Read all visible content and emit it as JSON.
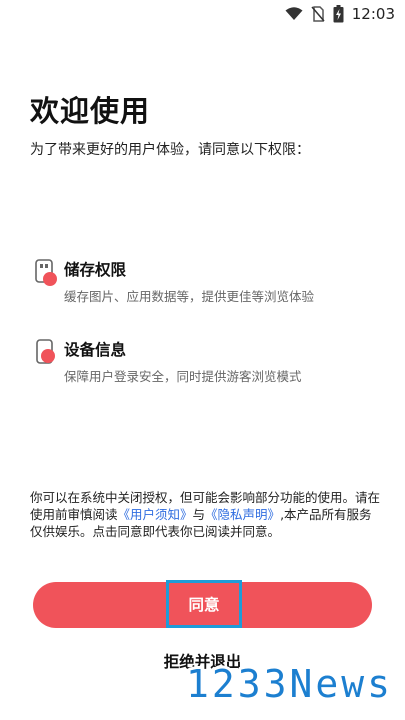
{
  "status_bar": {
    "time": "12:03",
    "icons": [
      "wifi-icon",
      "no-sim-icon",
      "battery-charging-icon"
    ]
  },
  "title": "欢迎使用",
  "subtitle": "为了带来更好的用户体验，请同意以下权限：",
  "permissions": [
    {
      "icon": "storage-icon",
      "title": "储存权限",
      "desc": "缓存图片、应用数据等，提供更佳等浏览体验"
    },
    {
      "icon": "device-info-icon",
      "title": "设备信息",
      "desc": "保障用户登录安全，同时提供游客浏览模式"
    }
  ],
  "notice": {
    "line1": "你可以在系统中关闭授权，但可能会影响部分功能的使用。请在使用前审慎阅读",
    "user_terms_link": "《用户须知》",
    "and": "与",
    "privacy_link": "《隐私声明》",
    "line2": ",本产品所有服务仅供娱乐。点击同意即代表你已阅读并同意。"
  },
  "buttons": {
    "agree": "同意",
    "reject": "拒绝并退出"
  },
  "watermark": "1233News",
  "colors": {
    "accent": "#f0535a",
    "link": "#2f6de0",
    "highlight": "#1e9cd8",
    "watermark": "#1c7fd0"
  }
}
